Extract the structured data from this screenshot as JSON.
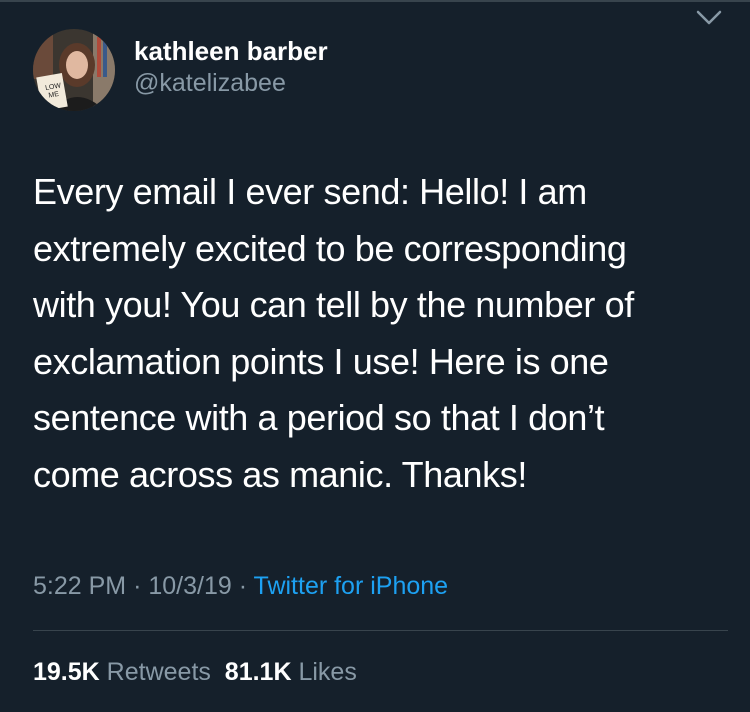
{
  "tweet": {
    "author": {
      "name": "kathleen barber",
      "handle": "@katelizabee",
      "avatar": {
        "book_text_line1": "LOW",
        "book_text_line2": "ME"
      }
    },
    "menu_icon": "chevron-down-icon",
    "text_lines": [
      "Every email I ever send: Hello! I am",
      "extremely excited to be corresponding",
      "with you! You can tell by the number of",
      "exclamation points I use! Here is one",
      "sentence with a period so that I don’t",
      "come across as manic. Thanks!"
    ],
    "time": "5:22 PM",
    "separator": "·",
    "date": "10/3/19",
    "source": "Twitter for iPhone",
    "retweets_count": "19.5K",
    "retweets_label": "Retweets",
    "likes_count": "81.1K",
    "likes_label": "Likes"
  },
  "colors": {
    "background": "#15202b",
    "primary_text": "#ffffff",
    "secondary_text": "#8899a6",
    "link": "#1da1f2",
    "divider": "#38444d"
  }
}
